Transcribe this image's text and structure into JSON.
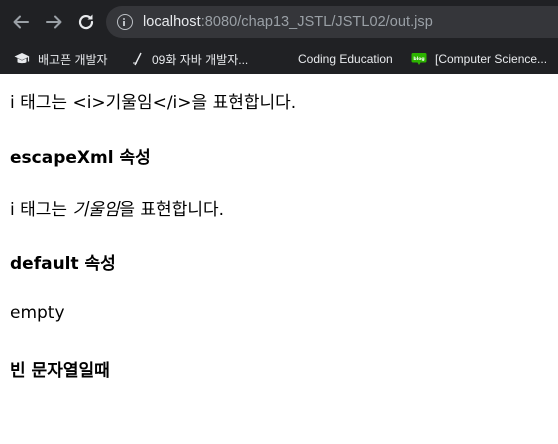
{
  "browser": {
    "url_host": "localhost",
    "url_path": ":8080/chap13_JSTL/JSTL02/out.jsp",
    "bookmarks": [
      {
        "label": "배고픈 개발자",
        "icon": "graduation-cap-icon"
      },
      {
        "label": "09화 자바 개발자...",
        "icon": "slash-page-icon"
      },
      {
        "label": "Coding Education",
        "icon": ""
      },
      {
        "label": "[Computer Science...",
        "icon": "blog-icon",
        "icon_text": "blog"
      }
    ]
  },
  "content": {
    "line1": "i 태그는 <i>기울임</i>을 표현합니다.",
    "heading1": "escapeXml 속성",
    "line2_before": "i 태그는 ",
    "line2_italic": "기울임",
    "line2_after": "을 표현합니다.",
    "heading2": "default 속성",
    "line3": "empty",
    "heading3": "빈 문자열일때"
  },
  "colors": {
    "chrome_bg": "#202124",
    "urlbar_bg": "#35363a",
    "blog_icon_green": "#2db400"
  }
}
